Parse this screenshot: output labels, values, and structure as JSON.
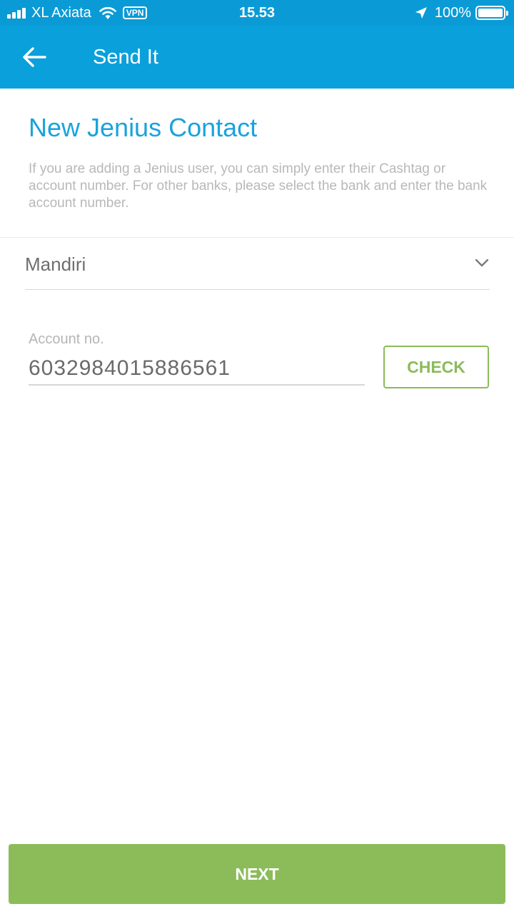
{
  "status_bar": {
    "carrier": "XL Axiata",
    "vpn": "VPN",
    "time": "15.53",
    "battery": "100%",
    "icons": [
      "signal-icon",
      "wifi-icon",
      "location-arrow-icon",
      "battery-icon"
    ]
  },
  "app_bar": {
    "title": "Send It",
    "back_icon": "arrow-left-icon",
    "color": "#0aa0db"
  },
  "form": {
    "heading": "New Jenius Contact",
    "description": "If you are adding a Jenius user, you can simply enter their Cashtag or account number. For other banks, please select the bank and enter the bank account number.",
    "bank_selected": "Mandiri",
    "account_label": "Account no.",
    "account_value": "6032984015886561",
    "check_label": "CHECK"
  },
  "footer": {
    "next_label": "NEXT",
    "accent": "#8cbc5a"
  }
}
